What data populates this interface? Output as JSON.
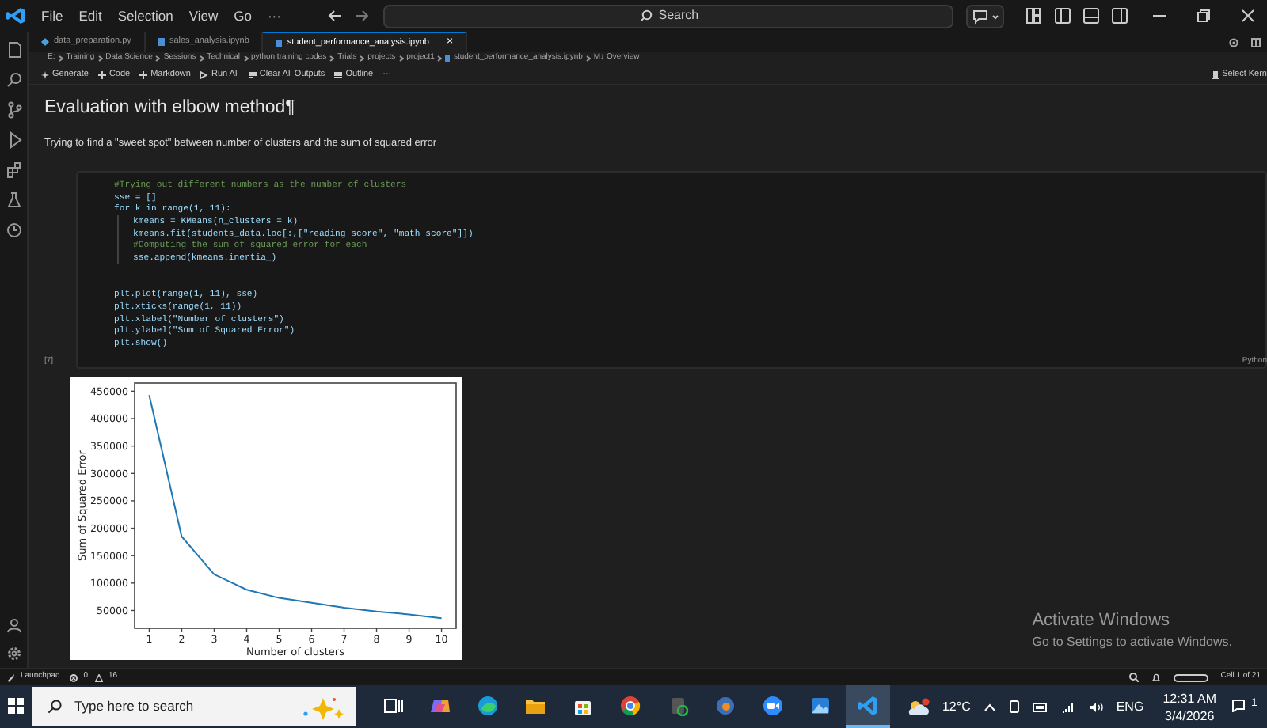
{
  "menubar": {
    "items": [
      "File",
      "Edit",
      "Selection",
      "View",
      "Go",
      "···"
    ],
    "search": {
      "placeholder": "Search"
    }
  },
  "tabs": [
    {
      "label": "data_preparation.py",
      "kind": "python",
      "selected": false
    },
    {
      "label": "sales_analysis.ipynb",
      "kind": "notebook",
      "selected": false
    },
    {
      "label": "student_performance_analysis.ipynb",
      "kind": "notebook",
      "selected": true,
      "close": "×"
    }
  ],
  "breadcrumb": [
    "E:",
    "Training",
    "Data Science",
    "Sessions",
    "Technical",
    "python training codes",
    "Trials",
    "projects",
    "project1",
    "student_performance_analysis.ipynb",
    "M↓ Overview"
  ],
  "toolbar": {
    "items": [
      {
        "label": "Generate",
        "kind": "sparkle"
      },
      {
        "label": "Code",
        "kind": "plus"
      },
      {
        "label": "Markdown",
        "kind": "plus"
      },
      {
        "label": "Run All",
        "kind": "run"
      },
      {
        "label": "Clear All Outputs",
        "kind": "clear"
      },
      {
        "label": "Outline",
        "kind": "list"
      },
      {
        "label": "···",
        "kind": "none"
      }
    ],
    "kernel": "Select Kern"
  },
  "notebook": {
    "heading": "Evaluation with elbow method¶",
    "paragraph": "Trying to find a \"sweet spot\" between number of clusters and the sum of squared error",
    "cell": {
      "execution_count": "[7]",
      "language": "Python",
      "lines": [
        {
          "text": "#Trying out different numbers as the number of clusters",
          "kind": "comment",
          "indent": false
        },
        {
          "text": "sse = []",
          "kind": "code",
          "indent": false
        },
        {
          "text": "for k in range(1, 11):",
          "kind": "code",
          "indent": false
        },
        {
          "text": "kmeans = KMeans(n_clusters = k)",
          "kind": "code",
          "indent": true
        },
        {
          "text": "kmeans.fit(students_data.loc[:,[\"reading score\", \"math score\"]])",
          "kind": "code",
          "indent": true
        },
        {
          "text": "#Computing the sum of squared error for each",
          "kind": "comment",
          "indent": true
        },
        {
          "text": "sse.append(kmeans.inertia_)",
          "kind": "code",
          "indent": true
        },
        {
          "kind": "blank"
        },
        {
          "kind": "blank"
        },
        {
          "text": "plt.plot(range(1, 11), sse)",
          "kind": "code",
          "indent": false
        },
        {
          "text": "plt.xticks(range(1, 11))",
          "kind": "code",
          "indent": false
        },
        {
          "text": "plt.xlabel(\"Number of clusters\")",
          "kind": "code",
          "indent": false
        },
        {
          "text": "plt.ylabel(\"Sum of Squared Error\")",
          "kind": "code",
          "indent": false
        },
        {
          "text": "plt.show()",
          "kind": "code",
          "indent": false
        }
      ]
    },
    "output": {
      "chart_data": {
        "type": "line",
        "xlabel": "Number of clusters",
        "ylabel": "Sum of Squared Error",
        "x": [
          1,
          2,
          3,
          4,
          5,
          6,
          7,
          8,
          9,
          10
        ],
        "series": [
          {
            "color": "#1f77b4",
            "values": [
              443000,
              185000,
              116000,
              88000,
              73000,
              64000,
              55000,
              48000,
              43000,
              36000
            ]
          }
        ],
        "xlim": [
          0.55,
          10.45
        ],
        "ylim": [
          17500,
          465000
        ],
        "xticks": [
          1,
          2,
          3,
          4,
          5,
          6,
          7,
          8,
          9,
          10
        ],
        "yticks": [
          50000,
          100000,
          150000,
          200000,
          250000,
          300000,
          350000,
          400000,
          450000
        ]
      }
    }
  },
  "watermark_notice": {
    "title": "Activate Windows",
    "text": "Go to Settings to activate Windows."
  },
  "status_bar": {
    "launchpad": "Launchpad",
    "errors": "0",
    "warnings": "16",
    "cell": "Cell 1 of 21"
  },
  "taskbar": {
    "search": {
      "placeholder": "Type here to search"
    },
    "apps": [
      {
        "kind": "taskview",
        "selected": false
      },
      {
        "kind": "copilot",
        "selected": false
      },
      {
        "kind": "edge",
        "selected": false
      },
      {
        "kind": "folder",
        "selected": false
      },
      {
        "kind": "store",
        "selected": false
      },
      {
        "kind": "chrome",
        "selected": false
      },
      {
        "kind": "app",
        "selected": false
      },
      {
        "kind": "blender",
        "selected": false
      },
      {
        "kind": "zoom",
        "selected": false
      },
      {
        "kind": "photos",
        "selected": false
      },
      {
        "kind": "vscode",
        "selected": true
      }
    ],
    "temperature": "12°C",
    "language": "ENG",
    "time": "12:31 AM",
    "date": "3/4/2026",
    "notifications": "1"
  }
}
